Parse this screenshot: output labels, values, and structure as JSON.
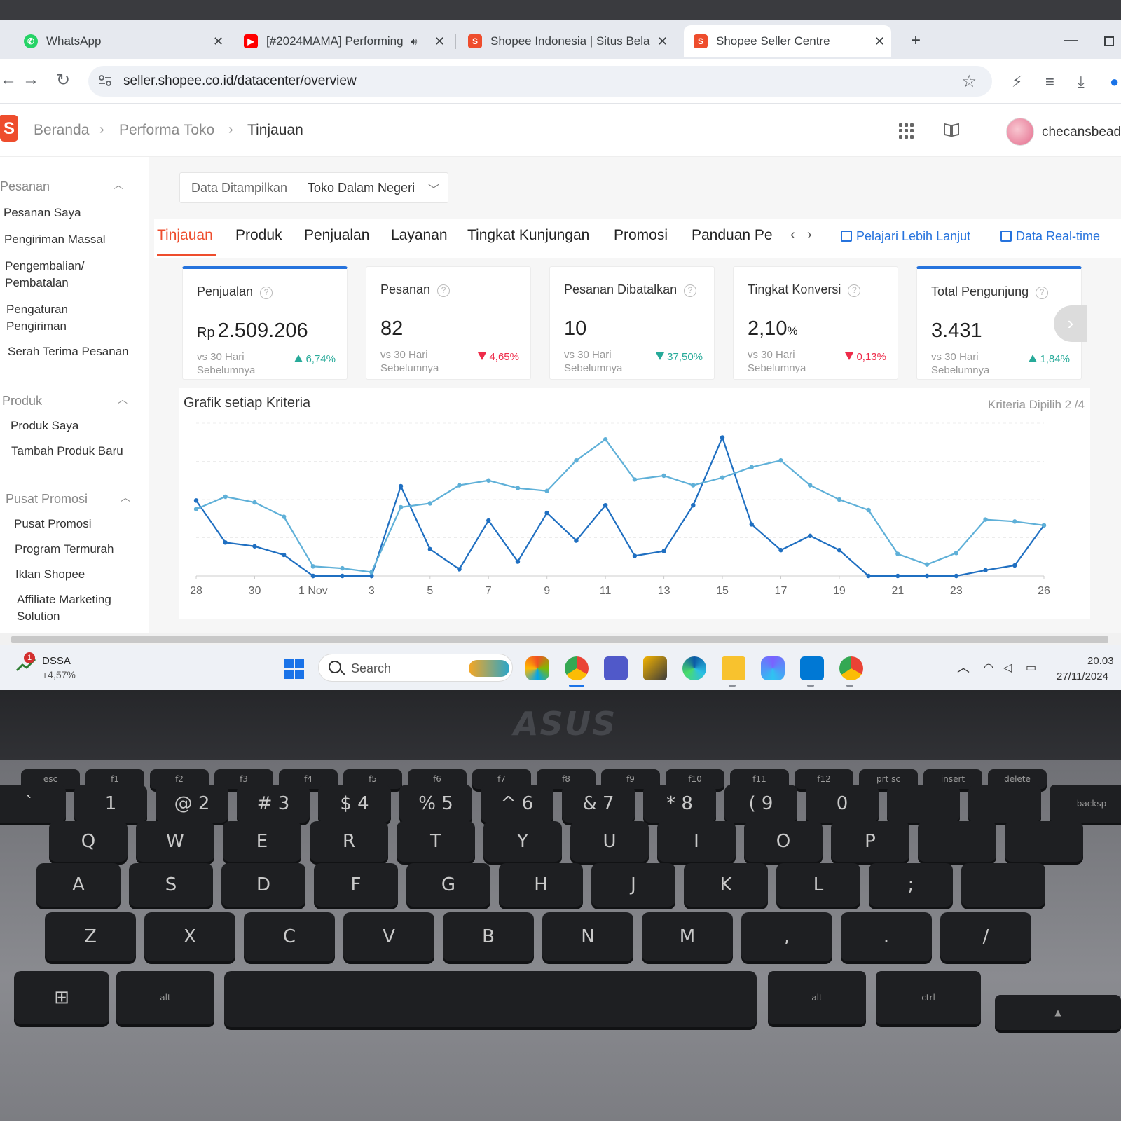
{
  "browser": {
    "tabs": [
      {
        "title": "WhatsApp",
        "icon": "whatsapp-icon",
        "icon_color": "#25d366"
      },
      {
        "title": "[#2024MAMA] Performing",
        "icon": "youtube-icon",
        "icon_color": "#ff0000"
      },
      {
        "title": "Shopee Indonesia | Situs Belanj",
        "icon": "shopee-icon",
        "icon_color": "#ee4d2d"
      },
      {
        "title": "Shopee Seller Centre",
        "icon": "shopee-icon",
        "icon_color": "#ee4d2d",
        "active": true
      }
    ],
    "url": "seller.shopee.co.id/datacenter/overview"
  },
  "header": {
    "breadcrumb": [
      "Beranda",
      "Performa Toko",
      "Tinjauan"
    ],
    "username": "checansbead"
  },
  "sidebar": {
    "groups": [
      {
        "label": "Pesanan",
        "items": [
          "Pesanan Saya",
          "Pengiriman Massal",
          "Pengembalian/ Pembatalan",
          "Pengaturan Pengiriman",
          "Serah Terima Pesanan"
        ]
      },
      {
        "label": "Produk",
        "items": [
          "Produk Saya",
          "Tambah Produk Baru"
        ]
      },
      {
        "label": "Pusat Promosi",
        "items": [
          "Pusat Promosi",
          "Program Termurah",
          "Iklan Shopee",
          "Affiliate Marketing Solution"
        ]
      }
    ]
  },
  "filter": {
    "label": "Data Ditampilkan",
    "value": "Toko Dalam Negeri"
  },
  "tabs": {
    "items": [
      "Tinjauan",
      "Produk",
      "Penjualan",
      "Layanan",
      "Tingkat Kunjungan",
      "Promosi",
      "Panduan Pe"
    ],
    "active": "Tinjauan",
    "learn_more": "Pelajari Lebih Lanjut",
    "realtime": "Data Real-time"
  },
  "kpis": [
    {
      "title": "Penjualan",
      "prefix": "Rp",
      "value": "2.509.206",
      "suffix": "",
      "vs": "vs 30 Hari Sebelumnya",
      "delta": "6,74%",
      "direction": "up",
      "selected": true
    },
    {
      "title": "Pesanan",
      "prefix": "",
      "value": "82",
      "suffix": "",
      "vs": "vs 30 Hari Sebelumnya",
      "delta": "4,65%",
      "direction": "down",
      "selected": false
    },
    {
      "title": "Pesanan Dibatalkan",
      "prefix": "",
      "value": "10",
      "suffix": "",
      "vs": "vs 30 Hari Sebelumnya",
      "delta": "37,50%",
      "direction": "down-good",
      "selected": false
    },
    {
      "title": "Tingkat Konversi",
      "prefix": "",
      "value": "2,10",
      "suffix": "%",
      "vs": "vs 30 Hari Sebelumnya",
      "delta": "0,13%",
      "direction": "down",
      "selected": false
    },
    {
      "title": "Total Pengunjung",
      "prefix": "",
      "value": "3.431",
      "suffix": "",
      "vs": "vs 30 Hari Sebelumnya",
      "delta": "1,84%",
      "direction": "up",
      "selected": true
    }
  ],
  "chart": {
    "title": "Grafik setiap Kriteria",
    "criteria": "Kriteria Dipilih 2 /4",
    "colors": {
      "dark": "#1f6fc1",
      "light": "#5fb0d8",
      "grid": "#ececec"
    }
  },
  "chart_data": {
    "type": "line",
    "x": [
      "28",
      "29",
      "30",
      "31",
      "1 Nov",
      "2",
      "3",
      "4",
      "5",
      "6",
      "7",
      "8",
      "9",
      "10",
      "11",
      "12",
      "13",
      "14",
      "15",
      "16",
      "17",
      "18",
      "19",
      "20",
      "21",
      "22",
      "23",
      "24",
      "25",
      "26"
    ],
    "x_tick_labels": [
      "28",
      "30",
      "1 Nov",
      "3",
      "5",
      "7",
      "9",
      "11",
      "13",
      "15",
      "17",
      "19",
      "21",
      "23",
      "26"
    ],
    "series": [
      {
        "values": [
          0.79,
          0.35,
          0.31,
          0.22,
          0.0,
          0.0,
          0.0,
          0.94,
          0.28,
          0.07,
          0.58,
          0.15,
          0.66,
          0.37,
          0.74,
          0.21,
          0.26,
          0.74,
          1.45,
          0.54,
          0.27,
          0.42,
          0.27,
          0.0,
          0.0,
          0.0,
          0.0,
          0.06,
          0.11,
          0.53
        ]
      },
      {
        "values": [
          0.7,
          0.83,
          0.77,
          0.62,
          0.1,
          0.08,
          0.04,
          0.72,
          0.76,
          0.95,
          1.0,
          0.92,
          0.89,
          1.21,
          1.43,
          1.01,
          1.05,
          0.95,
          1.03,
          1.14,
          1.21,
          0.95,
          0.8,
          0.69,
          0.23,
          0.12,
          0.24,
          0.59,
          0.57,
          0.53
        ]
      }
    ],
    "ylim": [
      0,
      1.6
    ],
    "grid": true,
    "legend": "none"
  },
  "taskbar": {
    "stock_name": "DSSA",
    "stock_change": "+4,57%",
    "badge": "1",
    "search_placeholder": "Search",
    "time": "20.03",
    "date": "27/11/2024"
  },
  "laptop": {
    "brand": "ASUS",
    "keys_row1": [
      "`",
      "1",
      "2",
      "3",
      "4",
      "5",
      "6",
      "7",
      "8",
      "9",
      "0"
    ],
    "keys_row1_shift": [
      "",
      "",
      "@",
      "#",
      "$",
      "%",
      "^",
      "&",
      "*",
      "(",
      ""
    ],
    "keys_row2": [
      "Q",
      "W",
      "E",
      "R",
      "T",
      "Y",
      "U",
      "I",
      "O",
      "P"
    ],
    "keys_row3": [
      "A",
      "S",
      "D",
      "F",
      "G",
      "H",
      "J",
      "K",
      "L",
      ";"
    ],
    "keys_row4": [
      "Z",
      "X",
      "C",
      "V",
      "B",
      "N",
      "M",
      ",",
      ".",
      "/"
    ],
    "fn_keys": [
      "esc",
      "f1",
      "f2",
      "f3",
      "f4",
      "f5",
      "f6",
      "f7",
      "f8",
      "f9",
      "f10",
      "f11",
      "f12",
      "prt sc",
      "insert",
      "delete"
    ],
    "mod_keys": {
      "alt_left": "alt",
      "alt_right": "alt",
      "ctrl": "ctrl",
      "backspace": "backsp"
    }
  }
}
